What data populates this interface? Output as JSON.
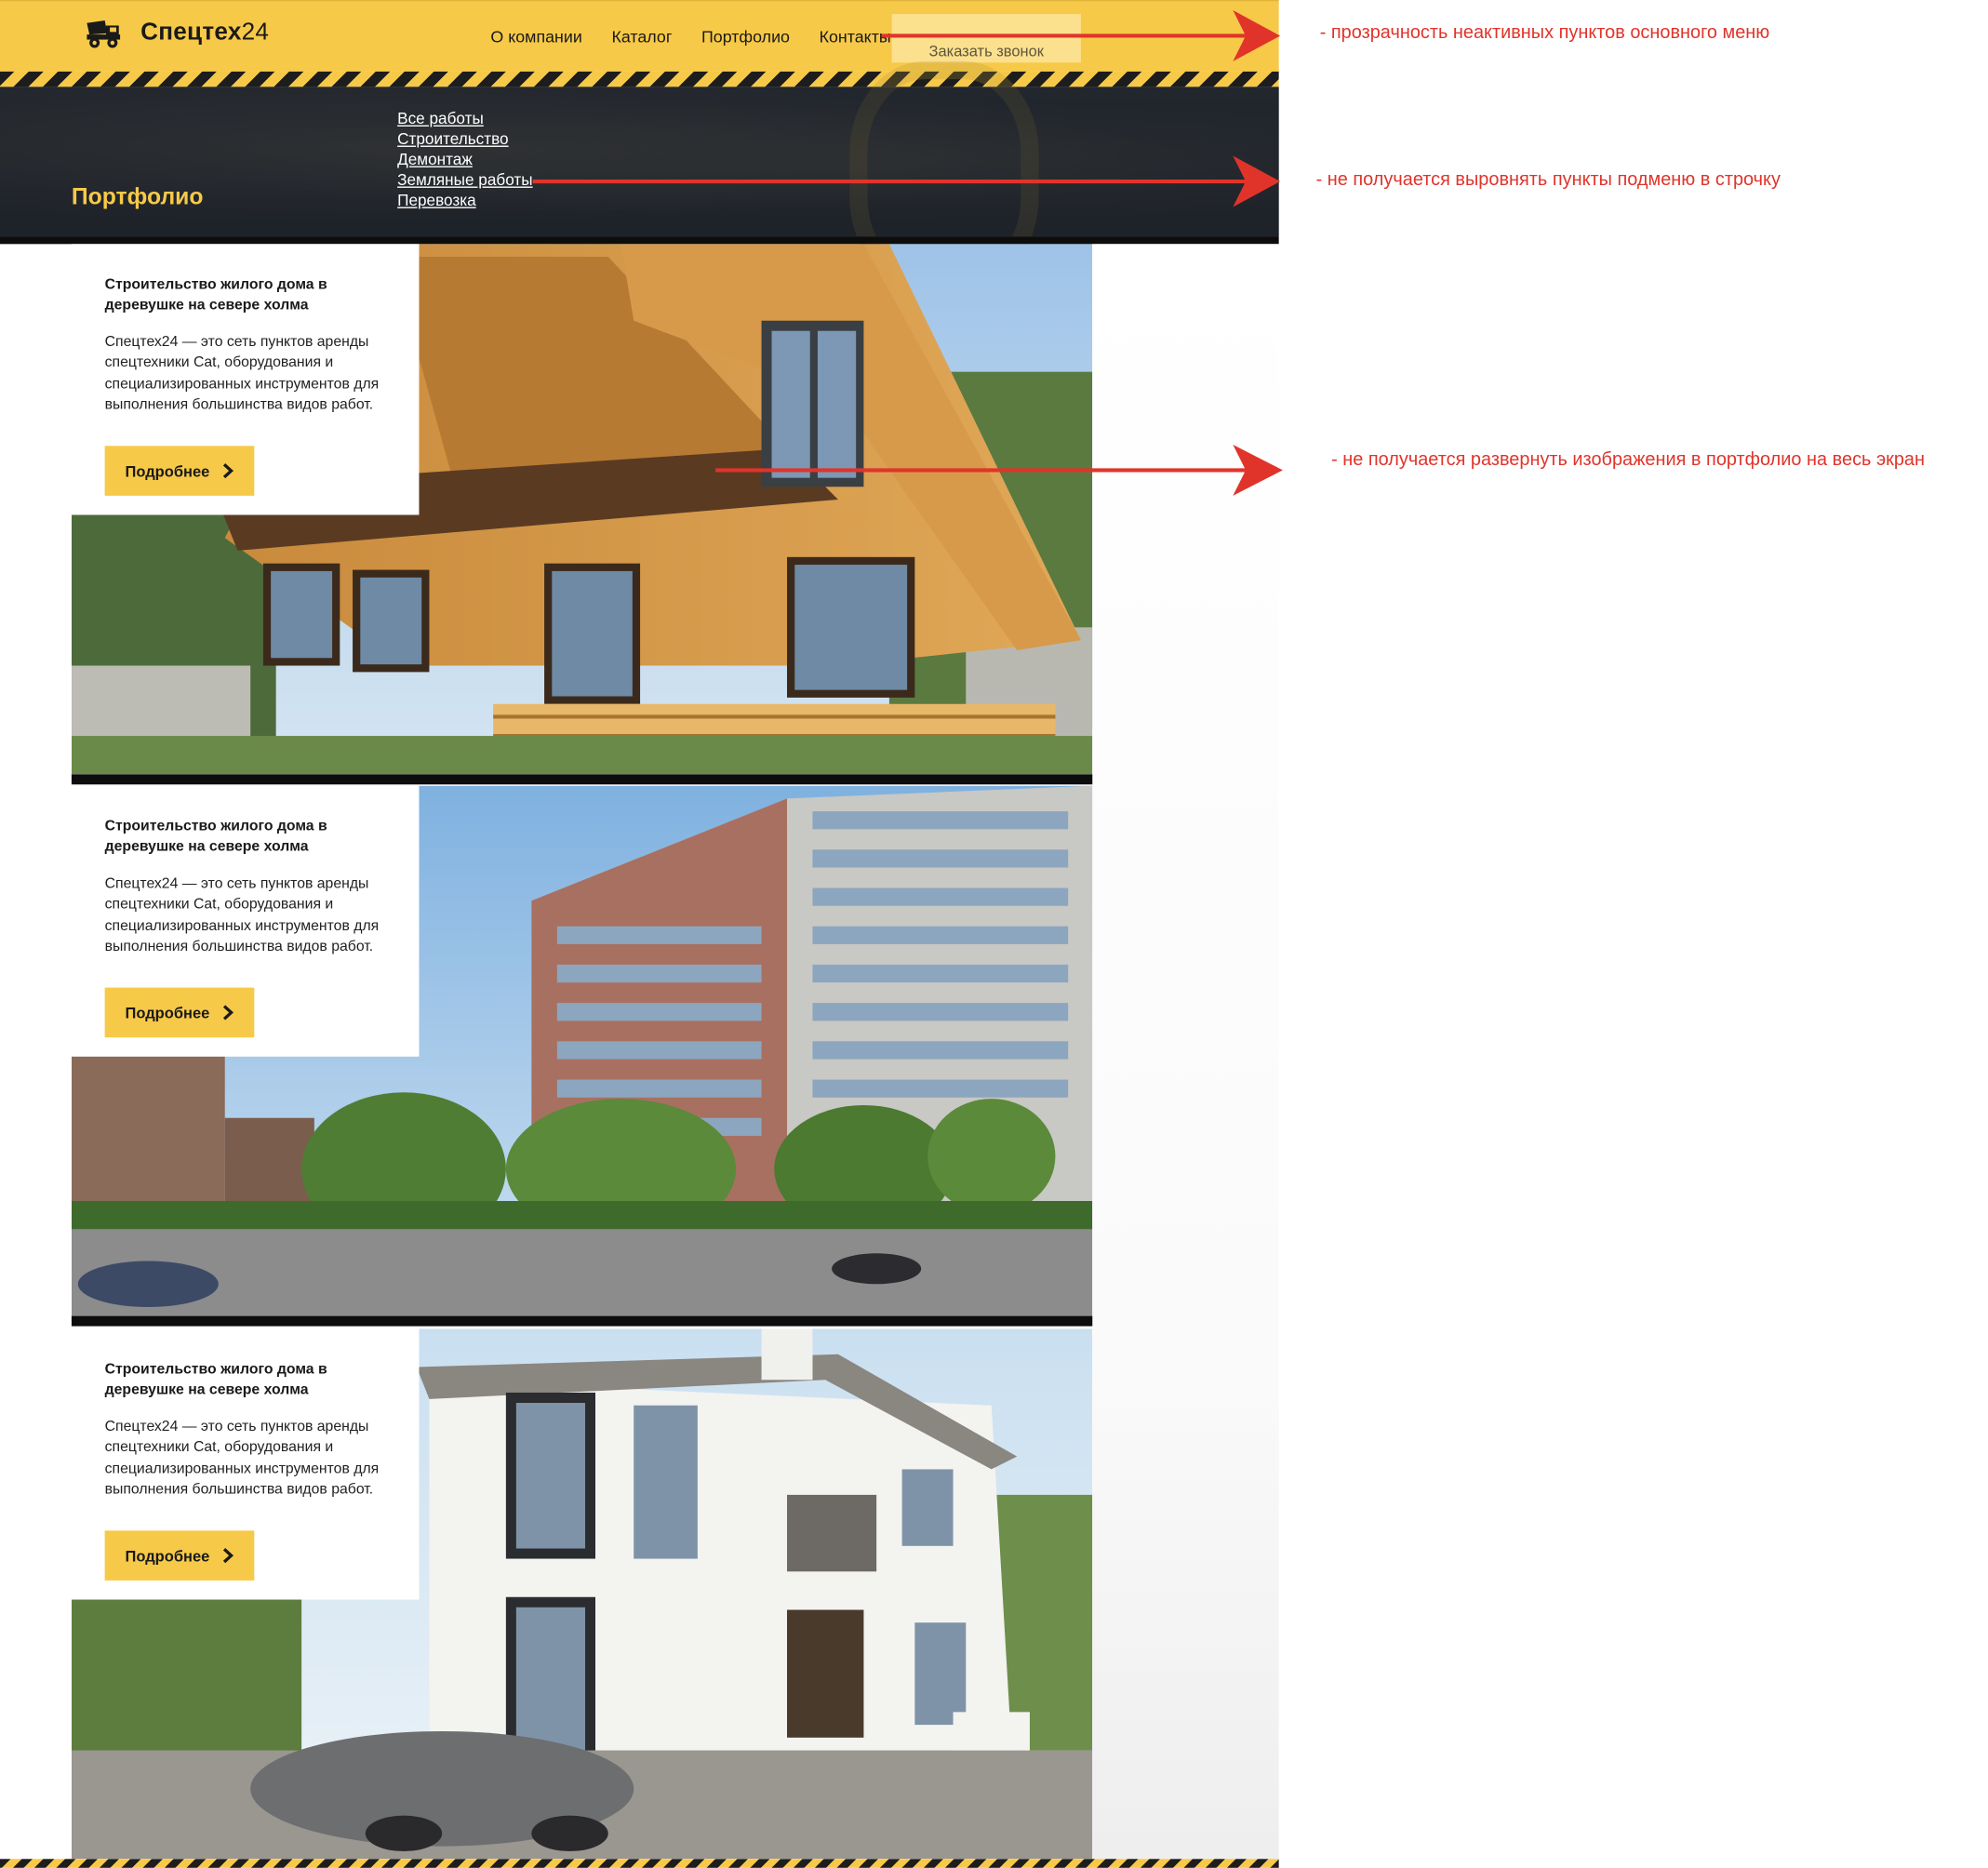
{
  "header": {
    "logo_text": "Спецтех",
    "logo_num": "24",
    "nav": [
      "О компании",
      "Каталог",
      "Портфолио",
      "Контакты"
    ],
    "call_button": "Заказать звонок"
  },
  "hero": {
    "title": "Портфолио",
    "submenu": [
      "Все работы",
      "Строительство",
      "Демонтаж",
      "Земляные работы",
      "Перевозка"
    ]
  },
  "portfolio": {
    "items": [
      {
        "title": "Строительство жилого дома в деревушке на севере холма",
        "text": "Спецтех24 — это сеть пунктов аренды спецтехники Cat, оборудования и специализированных инструментов для выполнения большинства видов работ.",
        "button": "Подробнее"
      },
      {
        "title": "Строительство жилого дома в деревушке на севере холма",
        "text": "Спецтех24 — это сеть пунктов аренды спецтехники Cat, оборудования и специализированных инструментов для выполнения большинства видов работ.",
        "button": "Подробнее"
      },
      {
        "title": "Строительство жилого дома в деревушке на севере холма",
        "text": "Спецтех24 — это сеть пунктов аренды спецтехники Cat, оборудования и специализированных инструментов для выполнения большинства видов работ.",
        "button": "Подробнее"
      }
    ]
  },
  "annotations": [
    "- прозрачность неактивных пунктов основного меню",
    "- не получается выровнять пункты подменю в строчку",
    "- не получается развернуть изображения в портфолио на весь экран"
  ],
  "colors": {
    "brand_yellow": "#f7c948",
    "annotation_red": "#e0342b",
    "hero_dark": "#22252b"
  },
  "icons": {
    "logo": "dump-truck-icon",
    "button": "chevron-right-icon"
  }
}
